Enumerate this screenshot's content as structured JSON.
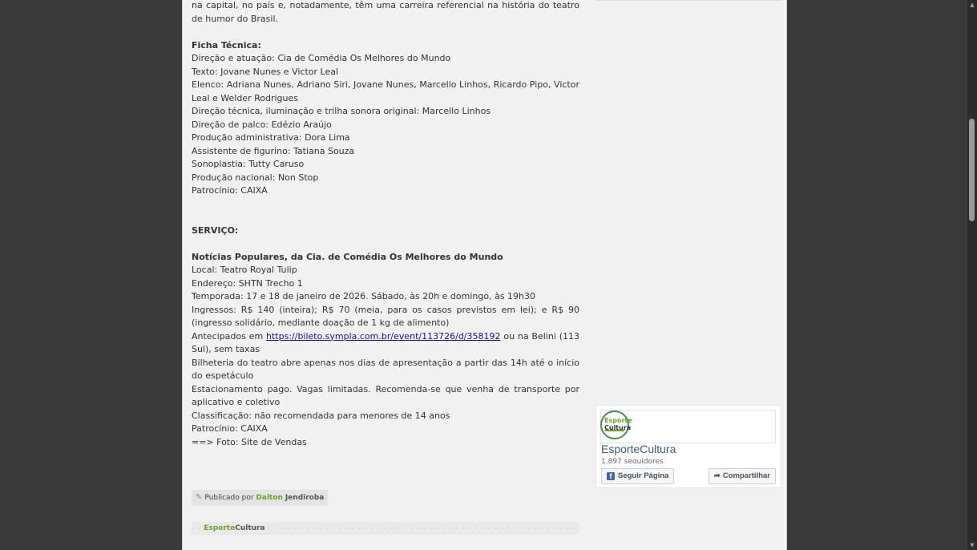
{
  "article": {
    "intro_tail": "na capital, no país e, notadamente, têm uma carreira referencial na história do teatro de humor do Brasil.",
    "ficha_title": "Ficha Técnica:",
    "ficha_lines": [
      "Direção e atuação: Cia de Comédia Os Melhores do Mundo",
      "Texto: Jovane Nunes e Victor Leal",
      "Elenco: Adriana Nunes, Adriano Siri, Jovane Nunes, Marcello Linhos, Ricardo Pipo, Victor Leal e Welder Rodrigues",
      "Direção técnica, iluminação e trilha sonora original: Marcello Linhos",
      "Direção de palco: Edézio Araújo",
      "Produção administrativa: Dora Lima",
      "Assistente de figurino: Tatiana Souza",
      "Sonoplastia: Tutty Caruso",
      "Produção nacional: Non Stop",
      "Patrocínio: CAIXA"
    ],
    "servico_title": "SERVIÇO:",
    "event_title": "Notícias Populares, da Cia. de Comédia Os Melhores do Mundo",
    "servico_lines": [
      "Local: Teatro Royal Tulip",
      "Endereço: SHTN Trecho 1",
      "Temporada: 17 e 18 de janeiro de 2026. Sábado, às 20h e domingo, às 19h30",
      "Ingressos: R$ 140 (inteira); R$ 70 (meia, para os casos previstos em lei); e R$ 90 (ingresso solidário, mediante doação de 1 kg de alimento)"
    ],
    "antecipados_prefix": "Antecipados em",
    "antecipados_link": "https://bileto.sympla.com.br/event/113726/d/358192",
    "antecipados_suffix": "ou na Belini (113 Sul), sem taxas",
    "servico_lines_after": [
      "Bilheteria do teatro abre apenas nos dias de apresentação a partir das 14h até o início do espetáculo",
      "Estacionamento pago. Vagas limitadas. Recomenda-se que venha de transporte por aplicativo e coletivo",
      "Classificação: não recomendada para menores de 14 anos",
      "Patrocínio: CAIXA"
    ],
    "photo_credit": "==> Foto: Site de Vendas"
  },
  "byline": {
    "prefix": "Publicado por",
    "first_name": "Dalton",
    "last_name": "Jendiroba"
  },
  "signature": {
    "brand_a": "Esporte",
    "brand_b": "Cultura"
  },
  "facebook_widget": {
    "logo_line1": "Esporte",
    "logo_line2": "Cultura",
    "page_name": "EsporteCultura",
    "followers": "1.897 seguidores",
    "follow_label": "Seguir Página",
    "share_label": "Compartilhar"
  },
  "colors": {
    "page_bg": "#f1f1f1",
    "outer_bg": "#3a3a3a",
    "brand_green": "#6ba32f",
    "link": "#1a0dab",
    "fb_blue": "#385898"
  },
  "icons": {
    "pencil": "pencil-icon",
    "facebook": "facebook-f-icon",
    "share": "share-arrow-icon"
  }
}
